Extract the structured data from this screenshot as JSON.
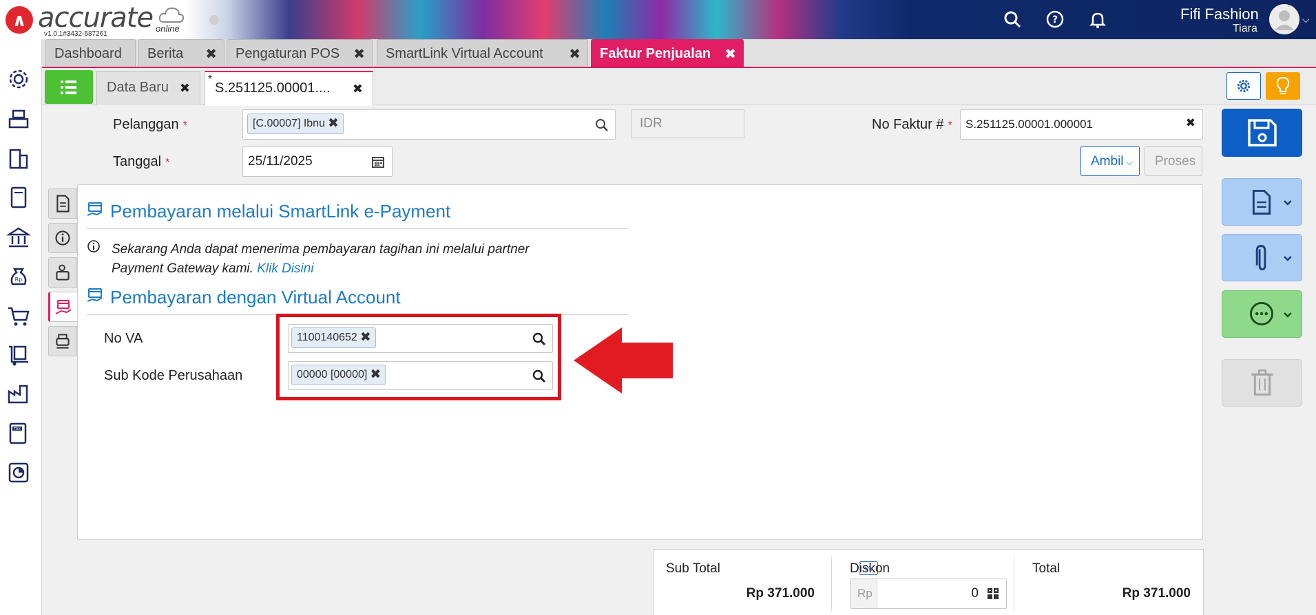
{
  "header": {
    "brand": "accurate",
    "brand_sub": "online",
    "version": "v1.0.1#3432-587261",
    "user_name": "Fifi Fashion",
    "user_sub": "Tiara"
  },
  "main_tabs": [
    {
      "label": "Dashboard"
    },
    {
      "label": "Berita"
    },
    {
      "label": "Pengaturan POS"
    },
    {
      "label": "SmartLink Virtual Account"
    },
    {
      "label": "Faktur Penjualan"
    }
  ],
  "tab_count": "5",
  "sub_tabs": [
    {
      "label": "Data Baru"
    },
    {
      "label": "S.251125.00001...."
    }
  ],
  "form": {
    "pelanggan_label": "Pelanggan",
    "pelanggan_value": "[C.00007] Ibnu",
    "currency": "IDR",
    "no_faktur_label": "No Faktur #",
    "no_faktur_value": "S.251125.00001.000001",
    "tanggal_label": "Tanggal",
    "tanggal_value": "25/11/2025",
    "ambil_label": "Ambil",
    "proses_label": "Proses",
    "required_mark": "*"
  },
  "panel": {
    "smartlink_title": "Pembayaran melalui SmartLink e-Payment",
    "info_text": "Sekarang Anda dapat menerima pembayaran tagihan ini melalui partner Payment Gateway kami.",
    "info_link": "Klik Disini",
    "va_title": "Pembayaran dengan Virtual Account",
    "no_va_label": "No VA",
    "no_va_value": "1100140652",
    "sub_kode_label": "Sub Kode Perusahaan",
    "sub_kode_value": "00000 [00000]"
  },
  "totals": {
    "sub_total_label": "Sub Total",
    "sub_total_value": "Rp 371.000",
    "diskon_label": "Diskon",
    "diskon_badge": "%",
    "diskon_prefix": "Rp",
    "diskon_value": "0",
    "total_label": "Total",
    "total_value": "Rp 371.000"
  },
  "colors": {
    "accent_pink": "#e11d63",
    "primary_blue": "#0e5fc5",
    "link_blue": "#1e7bc4",
    "highlight_red": "#d8151d"
  }
}
